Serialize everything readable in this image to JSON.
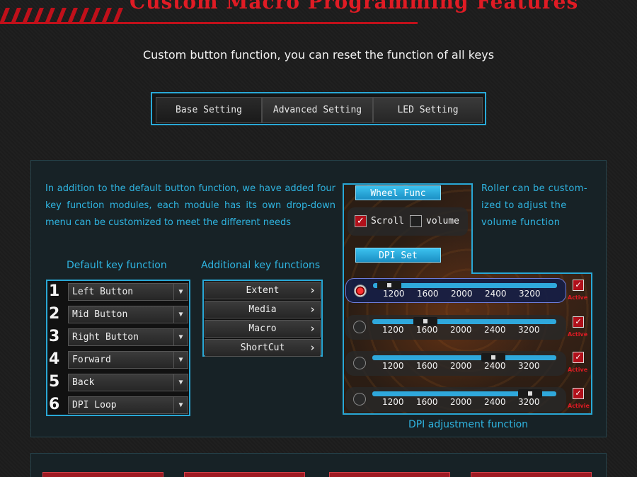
{
  "header": {
    "title": "Custom Macro Programming Features"
  },
  "subtitle": "Custom button function, you can reset the function of all keys",
  "tabs": [
    {
      "label": "Base Setting",
      "active": true
    },
    {
      "label": "Advanced Setting",
      "active": false
    },
    {
      "label": "LED Setting",
      "active": false
    }
  ],
  "intro": "In addition to the default button function, we have added four key function modules, each module has its own drop-down menu can be customized to meet the different needs",
  "default_keys": {
    "heading": "Default key function",
    "items": [
      {
        "num": "1",
        "label": "Left Button"
      },
      {
        "num": "2",
        "label": "Mid Button"
      },
      {
        "num": "3",
        "label": "Right Button"
      },
      {
        "num": "4",
        "label": "Forward"
      },
      {
        "num": "5",
        "label": "Back"
      },
      {
        "num": "6",
        "label": "DPI Loop"
      }
    ]
  },
  "additional_keys": {
    "heading": "Additional key functions",
    "items": [
      "Extent",
      "Media",
      "Macro",
      "ShortCut"
    ]
  },
  "wheel": {
    "title": "Wheel Func",
    "scroll_label": "Scroll",
    "scroll_checked": true,
    "volume_label": "volume",
    "volume_checked": false
  },
  "roller_text": "Roller can be custom-ized to adjust the volume function",
  "dpi": {
    "title": "DPI Set",
    "ticks": [
      "1200",
      "1600",
      "2000",
      "2400",
      "3200"
    ],
    "active_label": "Active",
    "active_label_alt": "Activie",
    "rows": [
      {
        "selected": true,
        "value": 1200,
        "active": true
      },
      {
        "selected": false,
        "value": 1600,
        "active": true
      },
      {
        "selected": false,
        "value": 2400,
        "active": true
      },
      {
        "selected": false,
        "value": 3200,
        "active": true
      }
    ],
    "caption": "DPI adjustment function"
  },
  "colors": {
    "accent": "#29a8d6",
    "text_accent": "#2fb4e0",
    "brand_red": "#e01b24"
  }
}
